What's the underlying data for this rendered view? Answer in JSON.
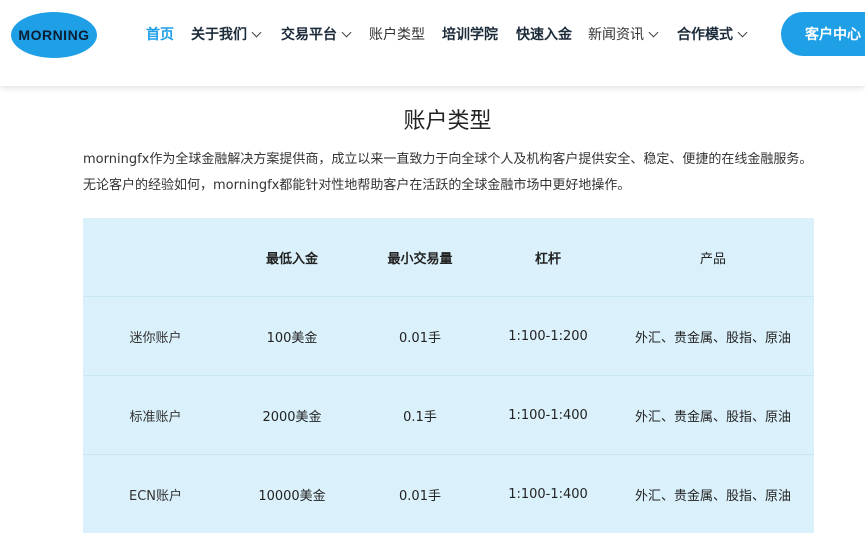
{
  "header": {
    "logo_text": "MORNING",
    "nav": [
      {
        "label": "首页"
      },
      {
        "label": "关于我们"
      },
      {
        "label": "交易平台"
      },
      {
        "label": "账户类型"
      },
      {
        "label": "培训学院"
      },
      {
        "label": "快速入金"
      },
      {
        "label": "新闻资讯"
      },
      {
        "label": "合作模式"
      }
    ],
    "client_button": "客户中心"
  },
  "main": {
    "title": "账户类型",
    "intro": "morningfx作为全球金融解决方案提供商，成立以来一直致力于向全球个人及机构客户提供安全、稳定、便捷的在线金融服务。无论客户的经验如何，morningfx都能针对性地帮助客户在活跃的全球金融市场中更好地操作。",
    "table": {
      "headers": [
        "",
        "最低入金",
        "最小交易量",
        "杠杆",
        "产品"
      ],
      "rows": [
        [
          "迷你账户",
          "100美金",
          "0.01手",
          "1:100-1:200",
          "外汇、贵金属、股指、原油"
        ],
        [
          "标准账户",
          "2000美金",
          "0.1手",
          "1:100-1:400",
          "外汇、贵金属、股指、原油"
        ],
        [
          "ECN账户",
          "10000美金",
          "0.01手",
          "1:100-1:400",
          "外汇、贵金属、股指、原油"
        ]
      ]
    }
  },
  "colors": {
    "accent": "#1e9fe6",
    "table_bg": "#daf1fb"
  }
}
